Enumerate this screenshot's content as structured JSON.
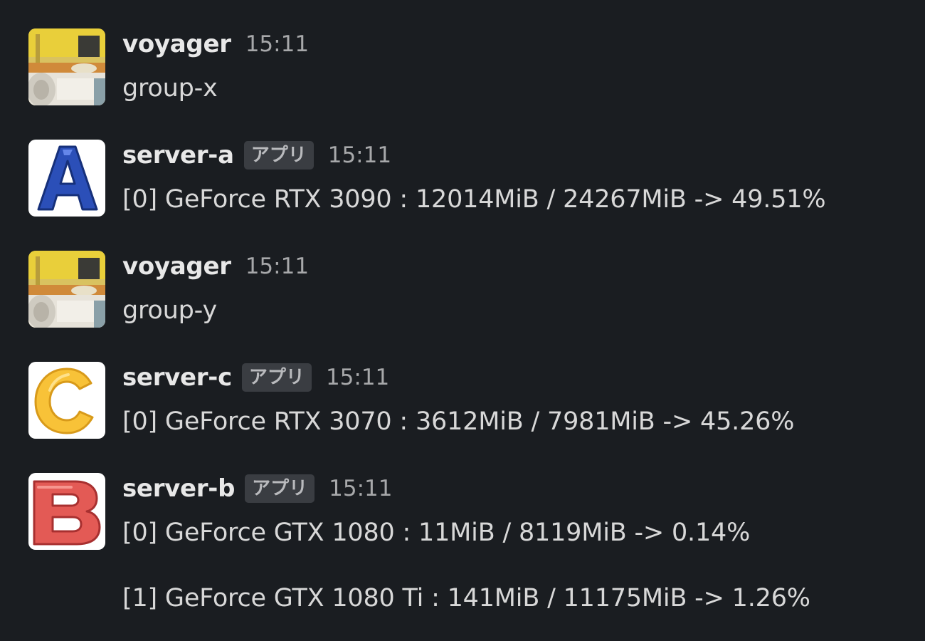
{
  "app_label": "アプリ",
  "messages": [
    {
      "author": "voyager",
      "time": "15:11",
      "avatar": "kitchen-photo-avatar",
      "lines": [
        "group-x"
      ]
    },
    {
      "author": "server-a",
      "time": "15:11",
      "avatar": "letter-a-avatar",
      "lines": [
        "[0] GeForce RTX 3090 : 12014MiB / 24267MiB -> 49.51%"
      ]
    },
    {
      "author": "voyager",
      "time": "15:11",
      "avatar": "kitchen-photo-avatar",
      "lines": [
        "group-y"
      ]
    },
    {
      "author": "server-c",
      "time": "15:11",
      "avatar": "letter-c-avatar",
      "lines": [
        "[0] GeForce RTX 3070 : 3612MiB / 7981MiB -> 45.26%"
      ]
    },
    {
      "author": "server-b",
      "time": "15:11",
      "avatar": "letter-b-avatar",
      "lines": [
        "[0] GeForce GTX 1080 : 11MiB / 8119MiB -> 0.14%",
        "[1] GeForce GTX 1080 Ti : 141MiB / 11175MiB -> 1.26%"
      ]
    }
  ]
}
